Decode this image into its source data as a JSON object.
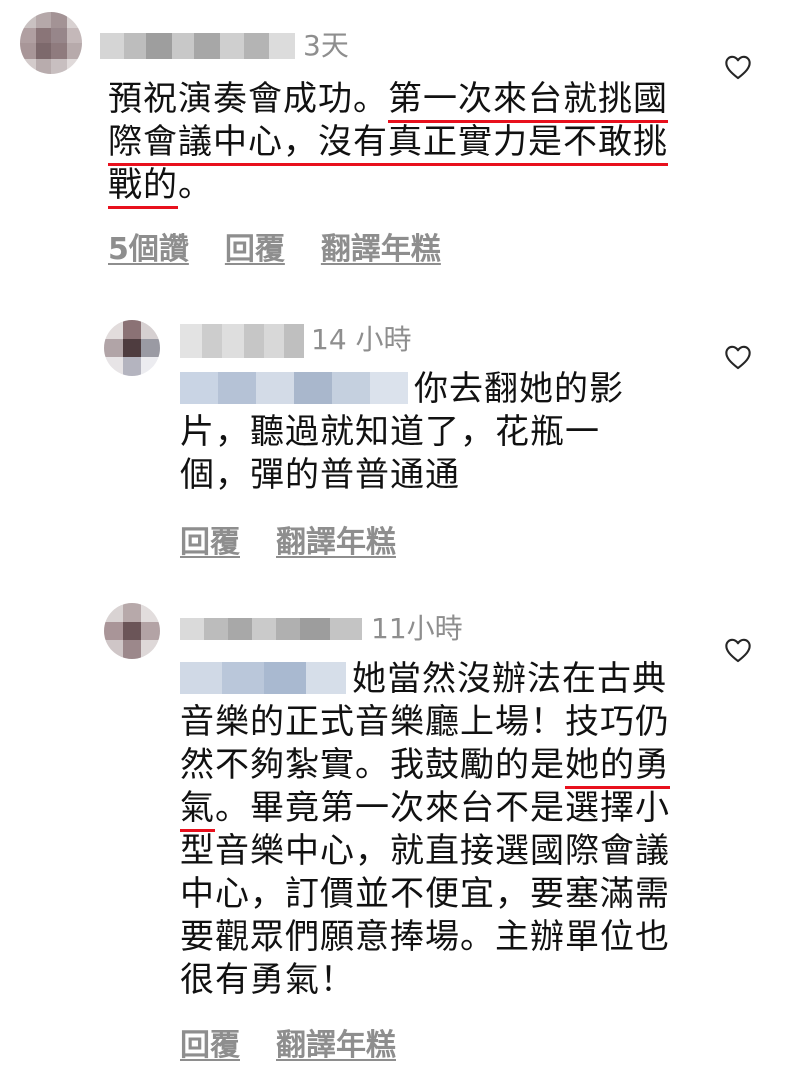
{
  "comments": [
    {
      "time": "3天",
      "text_before": "預祝演奏會成功。",
      "text_highlight": "第一次來台就挑國際會議中心，沒有真正實力是不敢挑戰的",
      "text_after": "。",
      "likes": "5個讚",
      "reply": "回覆",
      "translate": "翻譯年糕"
    },
    {
      "time": "14 小時",
      "text": "你去翻她的影片，聽過就知道了，花瓶一個，彈的普普通通",
      "reply": "回覆",
      "translate": "翻譯年糕"
    },
    {
      "time": "11小時",
      "text_first": "她當然沒辦法在古典音樂的正式音樂廳上場！技巧仍然不夠紮實。我鼓勵的是",
      "text_highlight": "她的勇氣",
      "text_rest": "。畢竟第一次來台不是選擇小型音樂中心，就直接選國際會議中心，訂價並不便宜，要塞滿需要觀眾們願意捧場。主辦單位也很有勇氣！",
      "reply": "回覆",
      "translate": "翻譯年糕"
    }
  ],
  "colors": {
    "underline": "#e8101d",
    "meta": "#8e8e8e",
    "text": "#111111"
  },
  "icons": {
    "like": "heart-outline-icon"
  }
}
